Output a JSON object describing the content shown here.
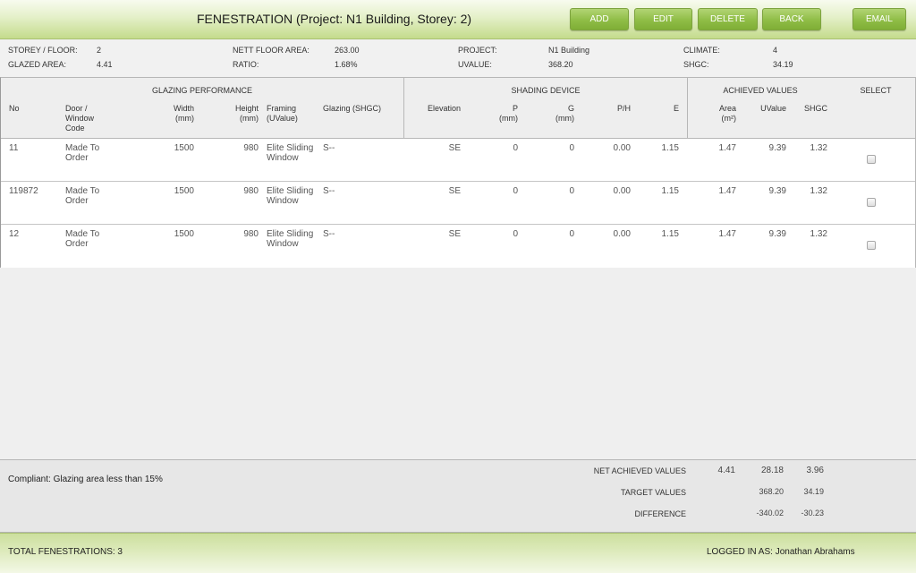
{
  "header": {
    "title": "FENESTRATION (Project: N1 Building, Storey: 2)",
    "buttons": {
      "add": "ADD",
      "edit": "EDIT",
      "delete": "DELETE",
      "back": "BACK",
      "email": "EMAIL"
    }
  },
  "info": {
    "storey_label": "STOREY / FLOOR:",
    "storey_value": "2",
    "glazed_label": "GLAZED AREA:",
    "glazed_value": "4.41",
    "nett_label": "NETT FLOOR AREA:",
    "nett_value": "263.00",
    "ratio_label": "RATIO:",
    "ratio_value": "1.68%",
    "project_label": "PROJECT:",
    "project_value": "N1 Building",
    "uvalue_label": "UVALUE:",
    "uvalue_value": "368.20",
    "climate_label": "CLIMATE:",
    "climate_value": "4",
    "shgc_label": "SHGC:",
    "shgc_value": "34.19"
  },
  "table": {
    "groups": {
      "glazing": "GLAZING PERFORMANCE",
      "shading": "SHADING DEVICE",
      "achieved": "ACHIEVED VALUES",
      "select": "SELECT"
    },
    "columns": {
      "no": "No",
      "door_1": "Door /",
      "door_2": "Window",
      "door_3": "Code",
      "width_1": "Width",
      "width_2": "(mm)",
      "height_1": "Height",
      "height_2": "(mm)",
      "framing_1": "Framing",
      "framing_2": "(UValue)",
      "glazing": "Glazing (SHGC)",
      "elevation": "Elevation",
      "p_1": "P",
      "p_2": "(mm)",
      "g_1": "G",
      "g_2": "(mm)",
      "ph": "P/H",
      "e": "E",
      "area_1": "Area",
      "area_2": "(m²)",
      "uvalue": "UValue",
      "shgc": "SHGC"
    },
    "rows": [
      {
        "no": "11",
        "code_1": "Made To",
        "code_2": "Order",
        "width": "1500",
        "height": "980",
        "framing_1": "Elite Sliding",
        "framing_2": "Window",
        "glazing": "S--",
        "elevation": "SE",
        "p": "0",
        "g": "0",
        "ph": "0.00",
        "e": "1.15",
        "area": "1.47",
        "uvalue": "9.39",
        "shgc": "1.32"
      },
      {
        "no": "119872",
        "code_1": "Made To",
        "code_2": "Order",
        "width": "1500",
        "height": "980",
        "framing_1": "Elite Sliding",
        "framing_2": "Window",
        "glazing": "S--",
        "elevation": "SE",
        "p": "0",
        "g": "0",
        "ph": "0.00",
        "e": "1.15",
        "area": "1.47",
        "uvalue": "9.39",
        "shgc": "1.32"
      },
      {
        "no": "12",
        "code_1": "Made To",
        "code_2": "Order",
        "width": "1500",
        "height": "980",
        "framing_1": "Elite Sliding",
        "framing_2": "Window",
        "glazing": "S--",
        "elevation": "SE",
        "p": "0",
        "g": "0",
        "ph": "0.00",
        "e": "1.15",
        "area": "1.47",
        "uvalue": "9.39",
        "shgc": "1.32"
      }
    ]
  },
  "summary": {
    "compliant": "Compliant: Glazing area less than 15%",
    "net_label": "NET ACHIEVED VALUES",
    "net_area": "4.41",
    "net_uvalue": "28.18",
    "net_shgc": "3.96",
    "target_label": "TARGET VALUES",
    "target_uvalue": "368.20",
    "target_shgc": "34.19",
    "diff_label": "DIFFERENCE",
    "diff_uvalue": "-340.02",
    "diff_shgc": "-30.23"
  },
  "footer": {
    "total": "TOTAL FENESTRATIONS: 3",
    "logged_in": "LOGGED IN AS: Jonathan Abrahams"
  },
  "colors": {
    "accent_green": "#8fbd46",
    "header_bg": "#e4f0c8"
  }
}
